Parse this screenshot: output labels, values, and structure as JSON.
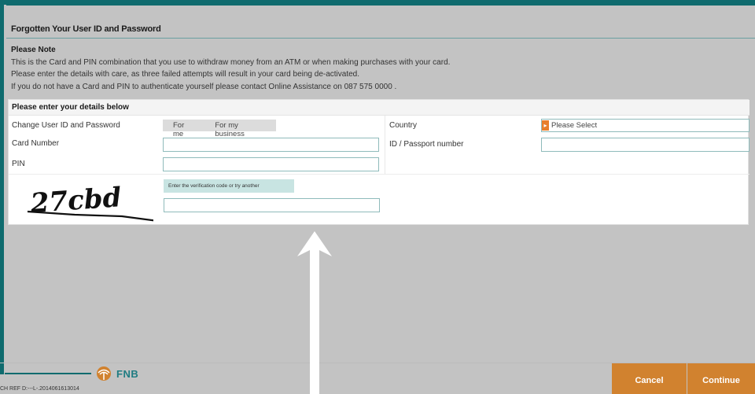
{
  "page": {
    "title": "Forgotten Your User ID and Password"
  },
  "note": {
    "heading": "Please Note",
    "lines": [
      "This is the Card and PIN combination that you use to withdraw money from an ATM or when making purchases with your card.",
      "Please enter the details with care, as three failed attempts will result in your card being de-activated.",
      "If you do not have a Card and PIN to authenticate yourself please contact Online Assistance on 087 575 0000 ."
    ]
  },
  "form": {
    "heading": "Please enter your details below",
    "change_label": "Change User ID and Password",
    "toggle_options": [
      "For me",
      "For my business"
    ],
    "card_number_label": "Card Number",
    "card_number_value": "",
    "pin_label": "PIN",
    "pin_value": "",
    "country_label": "Country",
    "country_value": "Please Select",
    "id_label": "ID / Passport number",
    "id_value": ""
  },
  "captcha": {
    "image_text": "27cbd",
    "hint": "Enter the verification code or try another",
    "value": ""
  },
  "footer": {
    "brand": "FNB",
    "ref": "CH REF D:---L-.2014061613014",
    "cancel_label": "Cancel",
    "continue_label": "Continue"
  },
  "colors": {
    "brand_teal": "#0f6b6e",
    "button_orange": "#d1822f",
    "select_arrow": "#e87e2a"
  },
  "icons": {
    "fnb_logo": "fnb-tree-logo-icon",
    "select_arrow": "chevron-right-icon",
    "overlay_arrow": "up-arrow-icon"
  }
}
